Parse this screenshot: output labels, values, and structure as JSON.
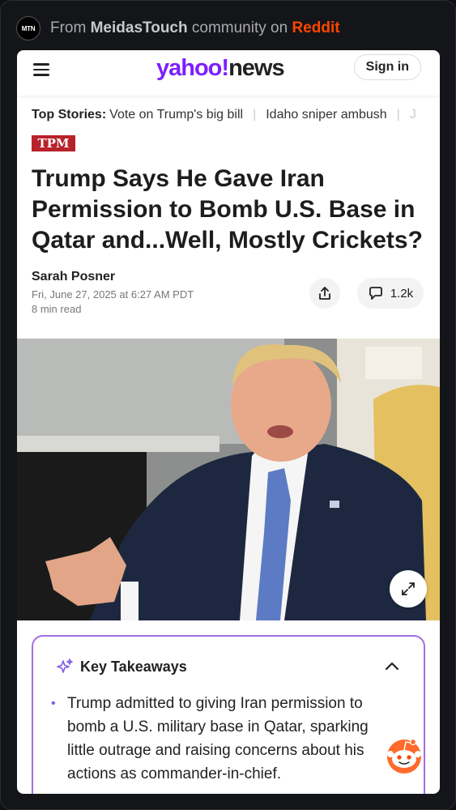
{
  "source": {
    "prefix": "From",
    "community": "MeidasTouch",
    "middle": "community on",
    "platform": "Reddit",
    "logo_text": "MTN"
  },
  "header": {
    "logo_yahoo": "yahoo!",
    "logo_news": "news",
    "signin": "Sign in"
  },
  "top_stories": {
    "label": "Top Stories:",
    "items": [
      "Vote on Trump's big bill",
      "Idaho sniper ambush",
      "J"
    ]
  },
  "article": {
    "source_badge": "TPM",
    "headline": "Trump Says He Gave Iran Permission to Bomb U.S. Base in Qatar and...Well, Mostly Crickets?",
    "author": "Sarah Posner",
    "date": "Fri, June 27, 2025 at 6:27 AM PDT",
    "read_time": "8 min read",
    "comments_count": "1.2k"
  },
  "takeaways": {
    "title": "Key Takeaways",
    "items": [
      "Trump admitted to giving Iran permission to bomb a U.S. military base in Qatar, sparking little outrage and raising concerns about his actions as commander-in-chief."
    ]
  },
  "icons": {
    "menu": "hamburger-icon",
    "share": "share-icon",
    "comments": "comment-icon",
    "expand": "expand-icon",
    "sparkle": "sparkle-icon",
    "collapse": "chevron-up-icon",
    "mascot": "reddit-snoo-icon"
  },
  "colors": {
    "yahoo_purple": "#7e1fff",
    "reddit_orange": "#ff4500",
    "tpm_red": "#b8222a",
    "takeaway_border": "#a66de4"
  }
}
